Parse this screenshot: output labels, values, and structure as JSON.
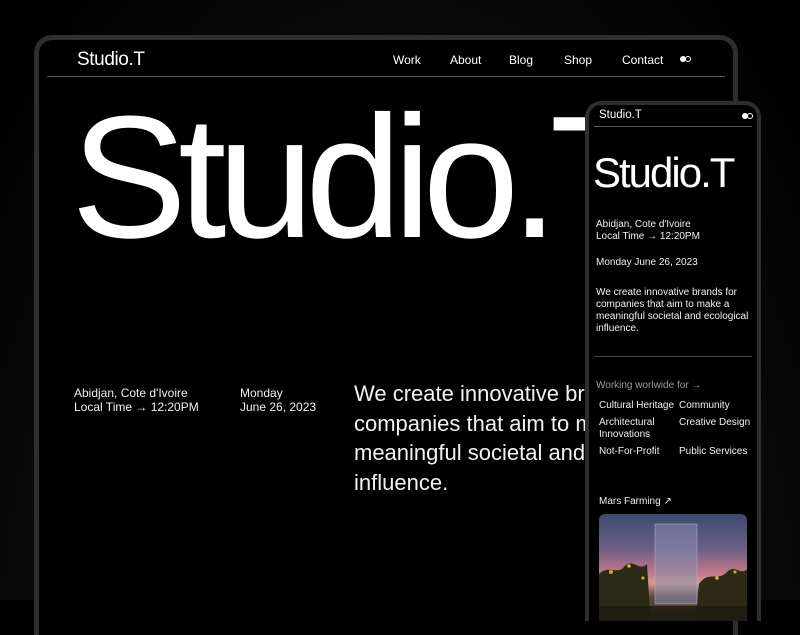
{
  "desktop": {
    "logo": "Studio.T",
    "nav": [
      "Work",
      "About",
      "Blog",
      "Shop",
      "Contact"
    ],
    "hero": "Studio.T",
    "location": "Abidjan, Cote d'Ivoire",
    "local_time": "Local Time → 12:20PM",
    "day": "Monday",
    "date": "June 26, 2023",
    "description": "We create innovative brands for\ncompanies that aim to make a\nmeaningful societal and ecological\ninfluence."
  },
  "mobile": {
    "logo": "Studio.T",
    "hero": "Studio.T",
    "location": "Abidjan, Cote d'Ivoire",
    "local_time": "Local Time → 12:20PM",
    "date": "Monday June 26, 2023",
    "description": "We create innovative brands for\ncompanies that aim to make a\nmeaningful societal and ecological\ninfluence.",
    "working_label": "Working worlwide for →",
    "sectors": [
      "Cultural Heritage",
      "Community",
      "Architectural Innovations",
      "Creative Design",
      "Not-For-Profit",
      "Public Services"
    ],
    "project": "Mars Farming ↗"
  },
  "colors": {
    "background": "#000000",
    "text": "#ffffff",
    "muted": "#9a9a9a",
    "frame": "#2e2e2e"
  },
  "icons": {
    "theme_toggle": "theme-toggle-icon",
    "project_link": "arrow-up-right-icon"
  }
}
